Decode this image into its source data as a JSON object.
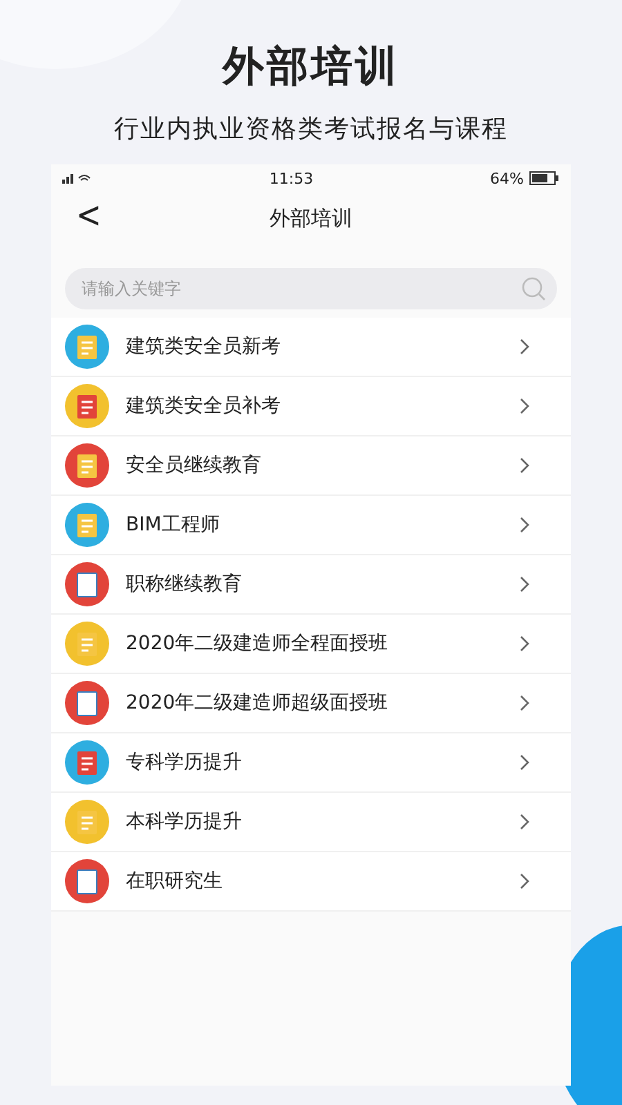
{
  "header": {
    "title": "外部培训",
    "subtitle": "行业内执业资格类考试报名与课程"
  },
  "status_bar": {
    "time": "11:53",
    "battery": "64%"
  },
  "nav": {
    "back": "<",
    "title": "外部培训"
  },
  "search": {
    "placeholder": "请输入关键字"
  },
  "items": [
    {
      "label": "建筑类安全员新考",
      "color": "#2eaee0"
    },
    {
      "label": "建筑类安全员补考",
      "color": "#f2c12e"
    },
    {
      "label": "安全员继续教育",
      "color": "#e2443a"
    },
    {
      "label": "BIM工程师",
      "color": "#2eaee0"
    },
    {
      "label": "职称继续教育",
      "color": "#e2443a"
    },
    {
      "label": "2020年二级建造师全程面授班",
      "color": "#f2c12e"
    },
    {
      "label": "2020年二级建造师超级面授班",
      "color": "#e2443a"
    },
    {
      "label": "专科学历提升",
      "color": "#2eaee0"
    },
    {
      "label": "本科学历提升",
      "color": "#f2c12e"
    },
    {
      "label": "在职研究生",
      "color": "#e2443a"
    }
  ]
}
